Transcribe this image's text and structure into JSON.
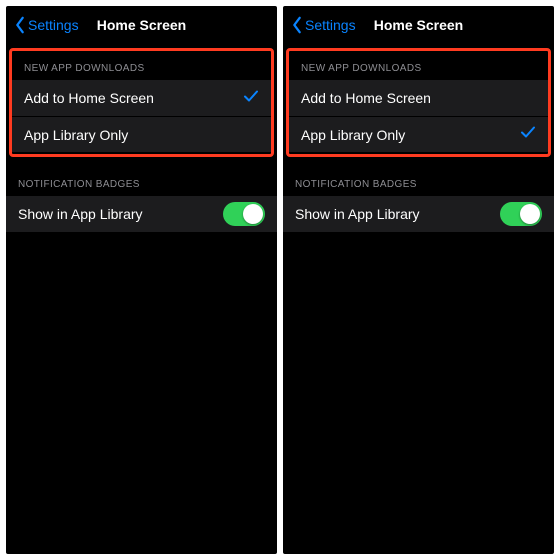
{
  "panes": [
    {
      "back_label": "Settings",
      "title": "Home Screen",
      "downloads_header": "NEW APP DOWNLOADS",
      "option_home": "Add to Home Screen",
      "option_library": "App Library Only",
      "selected": "home",
      "badges_header": "NOTIFICATION BADGES",
      "toggle_label": "Show in App Library",
      "toggle_on": true
    },
    {
      "back_label": "Settings",
      "title": "Home Screen",
      "downloads_header": "NEW APP DOWNLOADS",
      "option_home": "Add to Home Screen",
      "option_library": "App Library Only",
      "selected": "library",
      "badges_header": "NOTIFICATION BADGES",
      "toggle_label": "Show in App Library",
      "toggle_on": true
    }
  ]
}
